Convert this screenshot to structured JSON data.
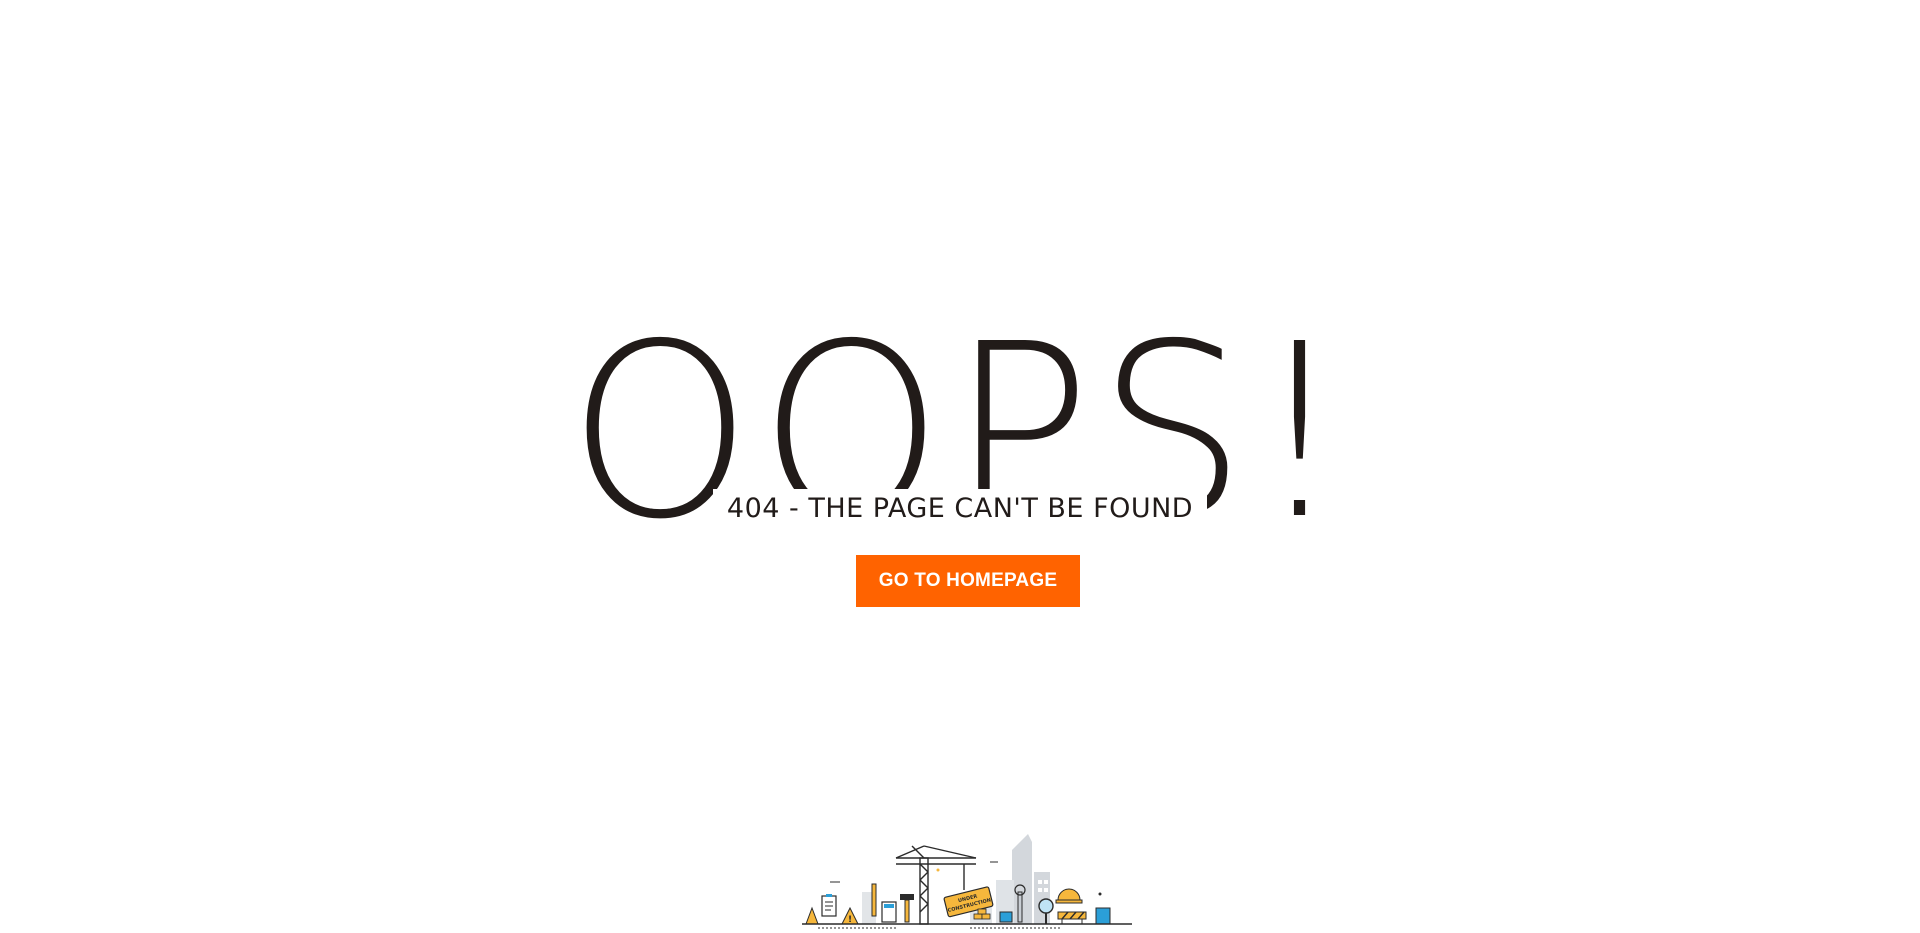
{
  "notfound": {
    "headline": "OOPS!",
    "subtitle": "404 - THE PAGE CAN'T BE FOUND",
    "button_label": "GO TO HOMEPAGE"
  },
  "colors": {
    "text": "#211b19",
    "accent": "#ff6300",
    "background": "#ffffff"
  },
  "illustration": {
    "icon": "under-construction-illustration",
    "sign_text_1": "UNDER",
    "sign_text_2": "CONSTRUCTION"
  }
}
